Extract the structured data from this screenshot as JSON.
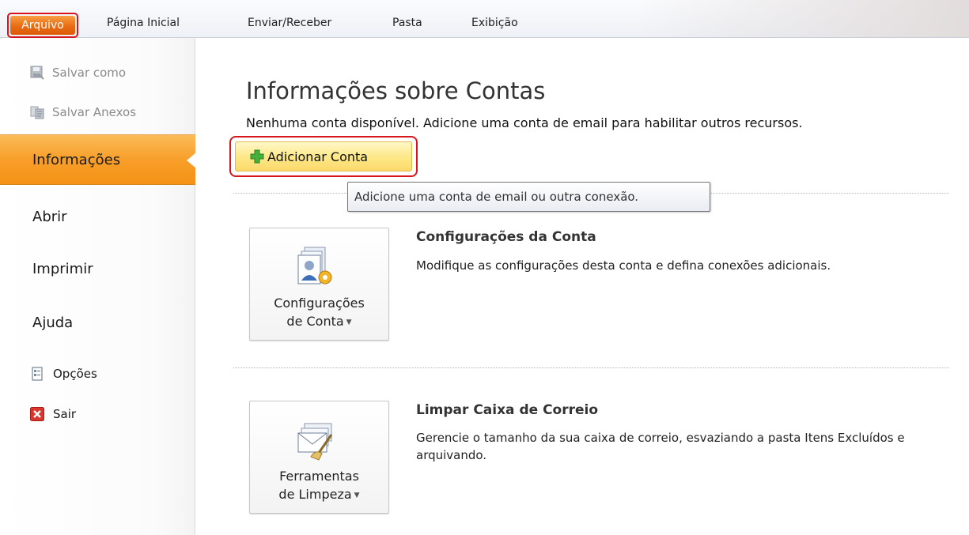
{
  "ribbon": {
    "tabs": [
      "Arquivo",
      "Página Inicial",
      "Enviar/Receber",
      "Pasta",
      "Exibição"
    ]
  },
  "backstage": {
    "commands": {
      "save_as": "Salvar como",
      "save_attachments": "Salvar Anexos"
    },
    "nav": {
      "info": "Informações",
      "open": "Abrir",
      "print": "Imprimir",
      "help": "Ajuda",
      "options": "Opções",
      "exit": "Sair"
    }
  },
  "main": {
    "title": "Informações sobre Contas",
    "subtitle": "Nenhuma conta disponível. Adicione uma conta de email para habilitar outros recursos.",
    "add_account_label": "Adicionar Conta",
    "tooltip": "Adicione uma conta de email ou outra conexão.",
    "sections": [
      {
        "button_line1": "Configurações",
        "button_line2": "de Conta",
        "title": "Configurações da Conta",
        "description": "Modifique as configurações desta conta e defina conexões adicionais."
      },
      {
        "button_line1": "Ferramentas",
        "button_line2": "de Limpeza",
        "title": "Limpar Caixa de Correio",
        "description": "Gerencie o tamanho da sua caixa de correio, esvaziando a pasta Itens Excluídos e arquivando."
      }
    ]
  },
  "colors": {
    "file_tab": "#e86c12",
    "active_nav": "#f89f2a",
    "highlight_border": "#d6161e",
    "add_button": "#fde98a"
  },
  "icons": {
    "save_as": "save-as-icon",
    "save_attachments": "save-attachments-icon",
    "options": "options-icon",
    "exit": "exit-icon",
    "add": "green-plus-icon",
    "account_settings": "account-settings-icon",
    "cleanup_tools": "cleanup-tools-icon"
  }
}
